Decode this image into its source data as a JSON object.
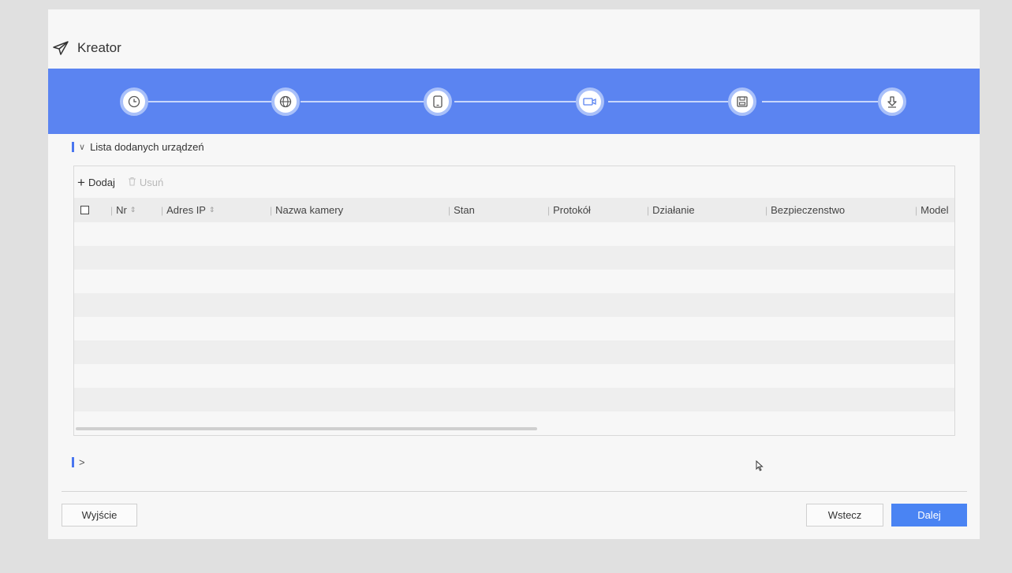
{
  "window": {
    "title": "Kreator"
  },
  "stepper": {
    "steps": [
      {
        "icon": "clock-icon"
      },
      {
        "icon": "globe-icon"
      },
      {
        "icon": "mobile-icon"
      },
      {
        "icon": "camera-icon"
      },
      {
        "icon": "save-icon"
      },
      {
        "icon": "download-icon"
      }
    ],
    "accent": "#5b84f1"
  },
  "section": {
    "title": "Lista dodanych urządzeń"
  },
  "toolbar": {
    "add_label": "Dodaj",
    "delete_label": "Usuń"
  },
  "table": {
    "columns": [
      "Nr",
      "Adres IP",
      "Nazwa kamery",
      "Stan",
      "Protokół",
      "Działanie",
      "Bezpieczenstwo",
      "Model"
    ],
    "rows": []
  },
  "footer": {
    "exit_label": "Wyjście",
    "back_label": "Wstecz",
    "next_label": "Dalej"
  },
  "colors": {
    "primary_button": "#4a84f3",
    "header_band": "#5b84f1"
  }
}
